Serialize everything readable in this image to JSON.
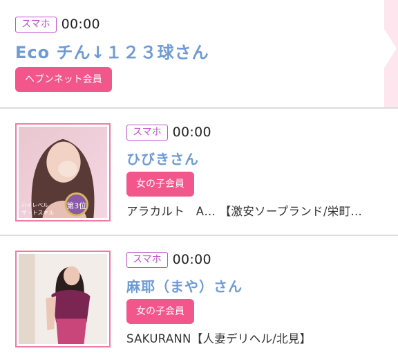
{
  "entries": [
    {
      "device": "スマホ",
      "time": "00:00",
      "name": "Eco チん↓１２３球さん",
      "member": "ヘブンネット会員"
    },
    {
      "device": "スマホ",
      "time": "00:00",
      "name": "ひびきさん",
      "member": "女の子会員",
      "shop": "アラカルト　A… 【激安ソープランド/栄町…",
      "photo_text": {
        "rank": "第3位",
        "caption1": "ハイレベル",
        "caption2": "ザ・トスキル"
      }
    },
    {
      "device": "スマホ",
      "time": "00:00",
      "name": "麻耶（まや）さん",
      "member": "女の子会員",
      "shop": "SAKURANN【人妻デリヘル/北見】"
    }
  ],
  "colors": {
    "name": "#6e9bd6",
    "member_button": "#f2568a",
    "device_badge": "#c24fd0",
    "thumb_border": "#f27aa3"
  }
}
